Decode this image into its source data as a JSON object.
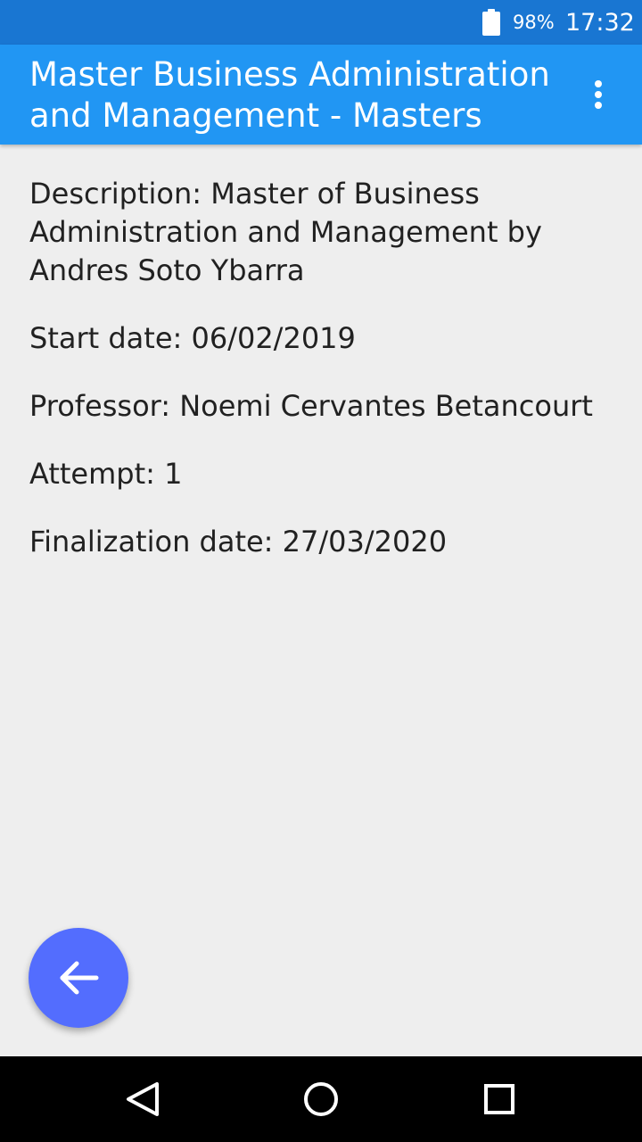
{
  "status_bar": {
    "battery_percent": "98%",
    "time": "17:32"
  },
  "app_bar": {
    "title": "Master Business Administration and Management - Masters",
    "menu_icon": "more-vert-icon"
  },
  "details": [
    {
      "text": "Description: Master of Business Administration and Management by Andres Soto Ybarra"
    },
    {
      "text": "Start date: 06/02/2019"
    },
    {
      "text": "Professor: Noemi Cervantes Betancourt"
    },
    {
      "text": "Attempt: 1"
    },
    {
      "text": "Finalization date: 27/03/2020"
    }
  ],
  "fab": {
    "icon": "arrow-back-icon"
  },
  "navigation": {
    "icons": [
      "back-triangle-icon",
      "home-circle-icon",
      "recents-square-icon"
    ]
  },
  "colors": {
    "status_bar": "#1976d2",
    "app_bar": "#2196f3",
    "background": "#eeeeee",
    "fab": "#536dfe",
    "text": "#212121"
  }
}
